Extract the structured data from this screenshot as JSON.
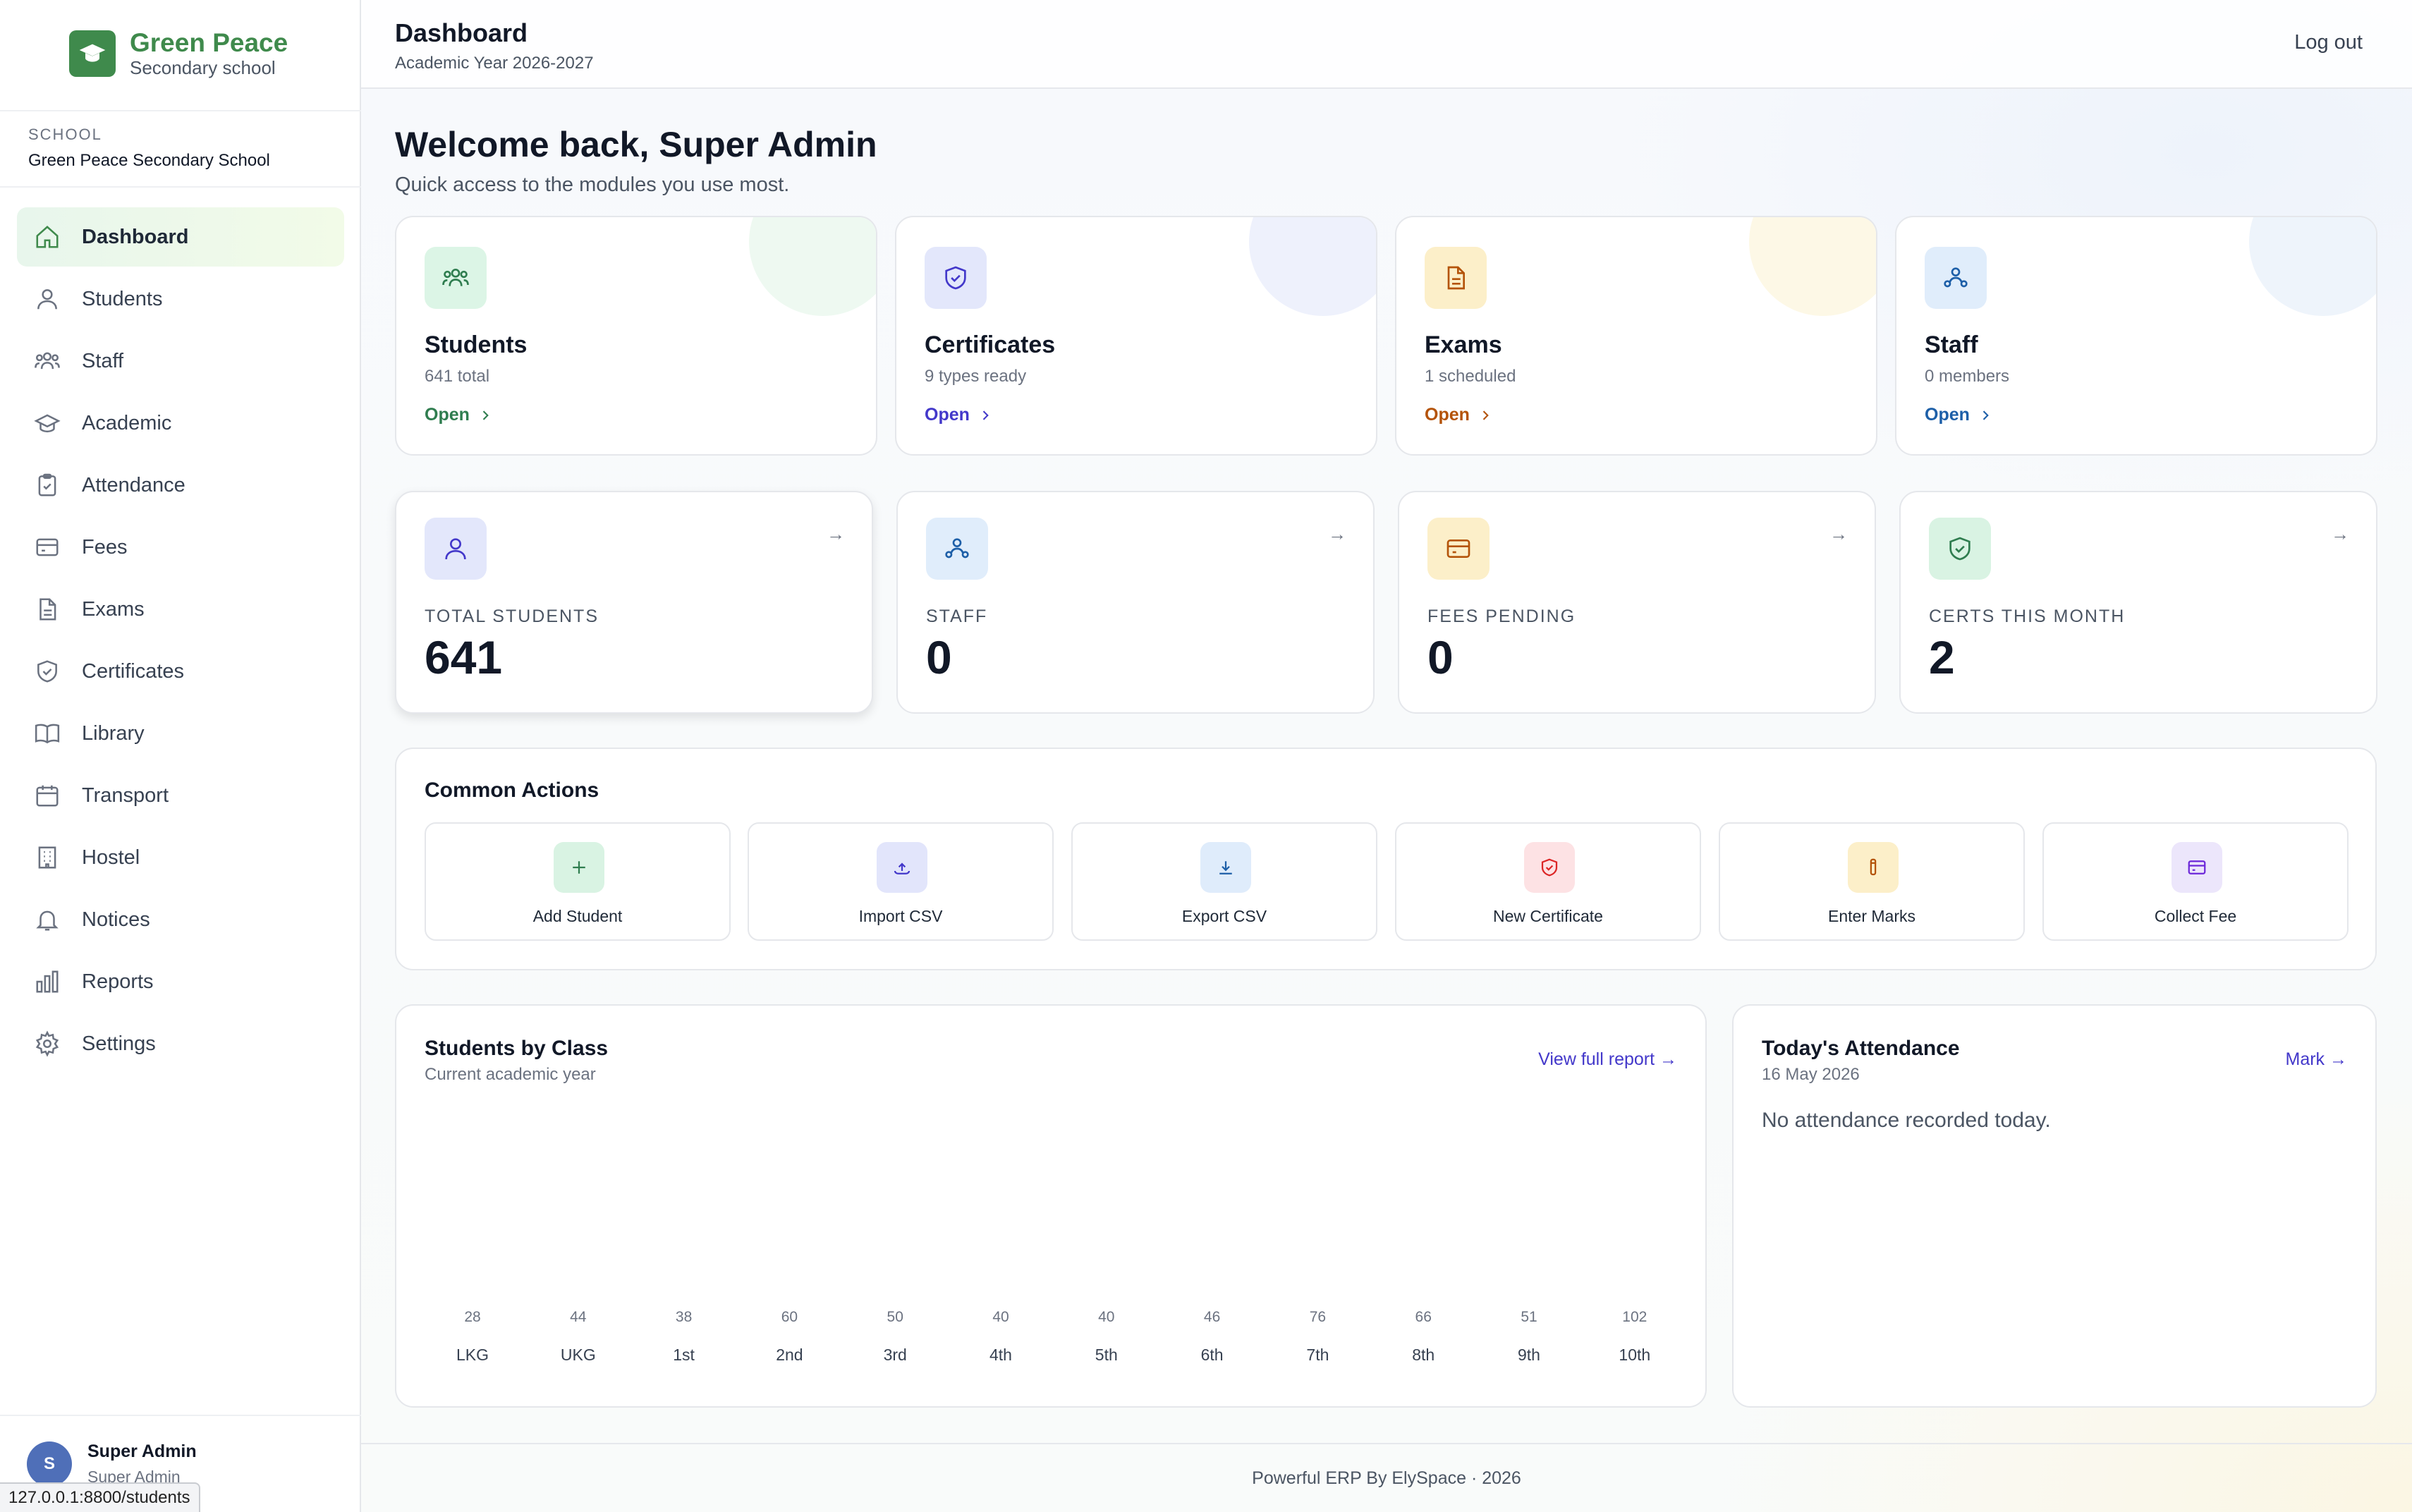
{
  "brand": {
    "name": "Green Peace",
    "subtitle": "Secondary school"
  },
  "school": {
    "label": "SCHOOL",
    "name": "Green Peace Secondary School"
  },
  "nav": [
    {
      "label": "Dashboard",
      "icon": "home-icon",
      "active": true
    },
    {
      "label": "Students",
      "icon": "user-icon"
    },
    {
      "label": "Staff",
      "icon": "users-icon"
    },
    {
      "label": "Academic",
      "icon": "graduation-cap-icon"
    },
    {
      "label": "Attendance",
      "icon": "clipboard-check-icon"
    },
    {
      "label": "Fees",
      "icon": "credit-card-icon"
    },
    {
      "label": "Exams",
      "icon": "file-text-icon"
    },
    {
      "label": "Certificates",
      "icon": "shield-check-icon"
    },
    {
      "label": "Library",
      "icon": "book-open-icon"
    },
    {
      "label": "Transport",
      "icon": "calendar-icon"
    },
    {
      "label": "Hostel",
      "icon": "building-icon"
    },
    {
      "label": "Notices",
      "icon": "bell-icon"
    },
    {
      "label": "Reports",
      "icon": "bar-chart-icon"
    },
    {
      "label": "Settings",
      "icon": "gear-icon"
    }
  ],
  "user": {
    "initial": "S",
    "name": "Super Admin",
    "role": "Super Admin"
  },
  "status_url": "127.0.0.1:8800/students",
  "header": {
    "title": "Dashboard",
    "subtitle": "Academic Year 2026-2027",
    "logout": "Log out"
  },
  "welcome": {
    "title": "Welcome back, Super Admin",
    "subtitle": "Quick access to the modules you use most."
  },
  "modules": [
    {
      "title": "Students",
      "sub": "641 total",
      "open": "Open",
      "accent": "#2f7d4f",
      "tile": "#dcf5e6",
      "deco": "#eef9f1"
    },
    {
      "title": "Certificates",
      "sub": "9 types ready",
      "open": "Open",
      "accent": "#4338ca",
      "tile": "#e3e7fb",
      "deco": "#eef1fc"
    },
    {
      "title": "Exams",
      "sub": "1 scheduled",
      "open": "Open",
      "accent": "#b45309",
      "tile": "#fcefc9",
      "deco": "#fdf8e6"
    },
    {
      "title": "Staff",
      "sub": "0 members",
      "open": "Open",
      "accent": "#1d5fa8",
      "tile": "#e0edfb",
      "deco": "#eef4fb"
    }
  ],
  "stats": [
    {
      "label": "TOTAL STUDENTS",
      "value": "641",
      "arrow": "→"
    },
    {
      "label": "STAFF",
      "value": "0",
      "arrow": "→"
    },
    {
      "label": "FEES PENDING",
      "value": "0",
      "arrow": "→"
    },
    {
      "label": "CERTS THIS MONTH",
      "value": "2",
      "arrow": "→"
    }
  ],
  "actions": {
    "title": "Common Actions",
    "items": [
      {
        "label": "Add Student",
        "icon": "plus-icon",
        "tile": "#d9f3e3",
        "color": "#2f7d4f"
      },
      {
        "label": "Import CSV",
        "icon": "upload-icon",
        "tile": "#e2e5fb",
        "color": "#4338ca"
      },
      {
        "label": "Export CSV",
        "icon": "download-icon",
        "tile": "#dfecfb",
        "color": "#1d5fa8"
      },
      {
        "label": "New Certificate",
        "icon": "shield-icon",
        "tile": "#fde2e4",
        "color": "#dc2626"
      },
      {
        "label": "Enter Marks",
        "icon": "pencil-icon",
        "tile": "#fcefc9",
        "color": "#b45309"
      },
      {
        "label": "Collect Fee",
        "icon": "credit-card-icon",
        "tile": "#ece6fb",
        "color": "#6d28d9"
      }
    ]
  },
  "chart_panel": {
    "title": "Students by Class",
    "subtitle": "Current academic year",
    "link": "View full report →"
  },
  "chart_data": {
    "type": "bar",
    "title": "Students by Class",
    "categories": [
      "LKG",
      "UKG",
      "1st",
      "2nd",
      "3rd",
      "4th",
      "5th",
      "6th",
      "7th",
      "8th",
      "9th",
      "10th"
    ],
    "values": [
      28,
      44,
      38,
      60,
      50,
      40,
      40,
      46,
      76,
      66,
      51,
      102
    ]
  },
  "attendance": {
    "title": "Today's Attendance",
    "date": "16 May 2026",
    "link": "Mark →",
    "empty": "No attendance recorded today."
  },
  "footer": "Powerful ERP By ElySpace · 2026"
}
